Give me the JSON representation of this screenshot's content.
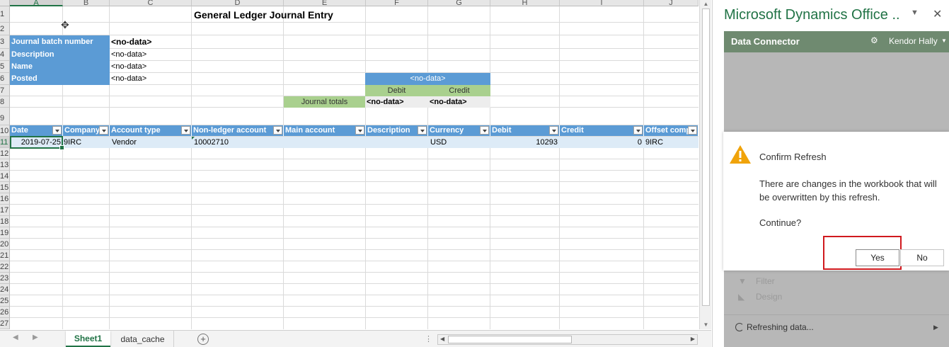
{
  "sheet": {
    "columns": [
      "A",
      "B",
      "C",
      "D",
      "E",
      "F",
      "G",
      "H",
      "I",
      "J"
    ],
    "rows": [
      "1",
      "2",
      "3",
      "4",
      "5",
      "6",
      "7",
      "8",
      "9",
      "10",
      "11",
      "12",
      "13",
      "14",
      "15",
      "16",
      "17",
      "18",
      "19",
      "20",
      "21",
      "22",
      "23",
      "24",
      "25",
      "26",
      "27"
    ],
    "title": "General Ledger Journal Entry",
    "header_fields": {
      "batch_label": "Journal batch number",
      "batch_value": "<no-data>",
      "description_label": "Description",
      "description_value": "<no-data>",
      "name_label": "Name",
      "name_value": "<no-data>",
      "posted_label": "Posted",
      "posted_value": "<no-data>"
    },
    "totals": {
      "header": "<no-data>",
      "debit_label": "Debit",
      "credit_label": "Credit",
      "journal_totals_label": "Journal totals",
      "debit_value": "<no-data>",
      "credit_value": "<no-data>"
    },
    "table_headers": [
      "Date",
      "Company",
      "Account type",
      "Non-ledger account",
      "Main account",
      "Description",
      "Currency",
      "Debit",
      "Credit",
      "Offset compa"
    ],
    "row": {
      "date": "2019-07-25",
      "company": "9IRC",
      "account_type": "Vendor",
      "non_ledger_account": "10002710",
      "main_account": "",
      "description": "",
      "currency": "USD",
      "debit": "10293",
      "credit": "0",
      "offset_company": "9IRC"
    }
  },
  "tabs": {
    "sheet1": "Sheet1",
    "data_cache": "data_cache",
    "add": "+"
  },
  "pane": {
    "title": "Microsoft Dynamics Office ..",
    "menu_icon": "chevron-down-icon",
    "close_icon": "close-icon",
    "header_title": "Data Connector",
    "user": "Kendor Hally",
    "filter_label": "Filter",
    "design_label": "Design",
    "refresh_status": "Refreshing data..."
  },
  "dialog": {
    "title": "Confirm Refresh",
    "message": "There are changes in the workbook that will be overwritten by this refresh.",
    "continue": "Continue?",
    "yes": "Yes",
    "no": "No"
  },
  "colors": {
    "excel_green": "#217346",
    "table_blue": "#5b9bd5",
    "totals_green": "#a9d08e",
    "row_highlight": "#ddebf7",
    "pane_header": "#6f8a70",
    "highlight_red": "#d0191e"
  }
}
